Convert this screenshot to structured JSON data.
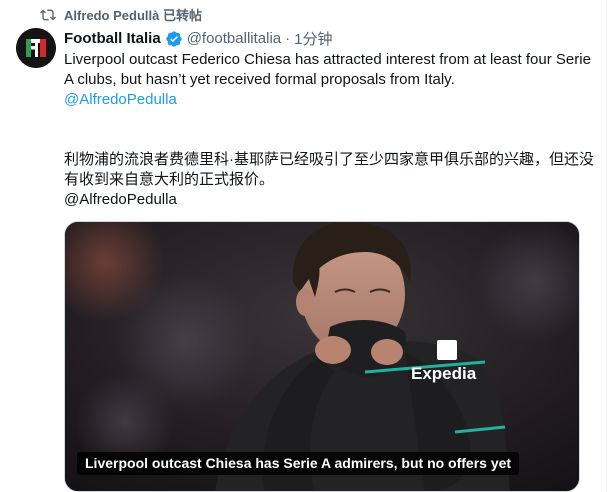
{
  "repost": {
    "user": "Alfredo Pedullà",
    "label": "已转帖",
    "icon": "repost-icon"
  },
  "author": {
    "name": "Football Italia",
    "handle": "@footballitalia",
    "separator": "·",
    "time": "1分钟",
    "verified": true,
    "avatar_icon": "football-italia-logo"
  },
  "post": {
    "text_en": "Liverpool outcast Federico Chiesa has attracted interest from at least four Serie A clubs, but hasn’t yet received formal proposals from Italy.",
    "mention_en": "@AlfredoPedulla",
    "text_cn": "利物浦的流浪者费德里科·基耶萨已经吸引了至少四家意甲俱乐部的兴趣，但还没有收到来自意大利的正式报价。",
    "mention_cn": "@AlfredoPedulla"
  },
  "media": {
    "caption": "Liverpool outcast Chiesa has Serie A admirers, but no offers yet",
    "sponsor_text": "Expedia"
  },
  "colors": {
    "accent": "#1d9bf0",
    "secondary_text": "#536471",
    "primary_text": "#0f1419"
  }
}
